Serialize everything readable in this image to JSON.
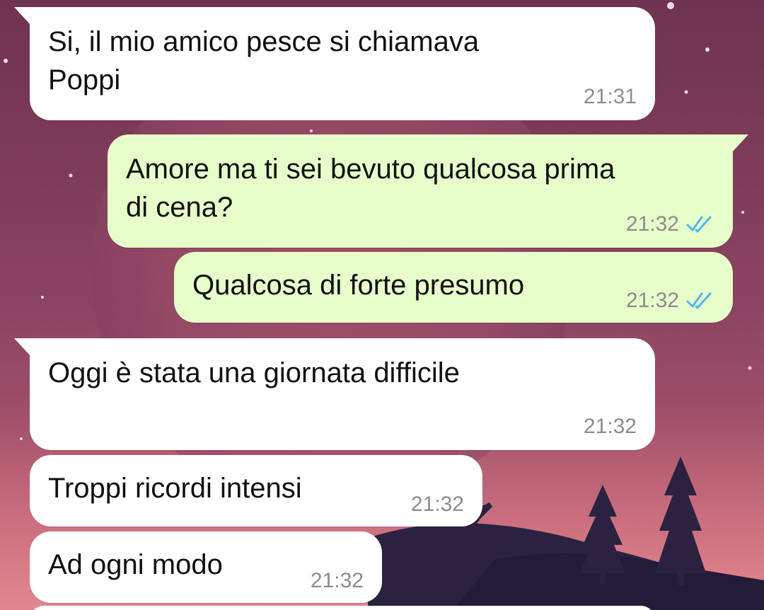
{
  "chat": {
    "theme": {
      "incoming_bubble": "#ffffff",
      "outgoing_bubble": "#e7fecb",
      "timestamp_color": "#8c8c8c",
      "read_tick_color": "#4fb6ec"
    },
    "messages": [
      {
        "direction": "incoming",
        "text": "Si, il mio amico pesce si chiamava\nPoppi",
        "time": "21:31"
      },
      {
        "direction": "outgoing",
        "text": "Amore ma ti sei bevuto qualcosa prima\ndi cena?",
        "time": "21:32",
        "status_icon": "double-check-icon"
      },
      {
        "direction": "outgoing",
        "text": "Qualcosa di forte presumo",
        "time": "21:32",
        "status_icon": "double-check-icon"
      },
      {
        "direction": "incoming",
        "text": "Oggi è stata una giornata difficile",
        "time": "21:32"
      },
      {
        "direction": "incoming",
        "text": "Troppi ricordi intensi",
        "time": "21:32"
      },
      {
        "direction": "incoming",
        "text": "Ad ogni modo",
        "time": "21:32"
      }
    ]
  }
}
